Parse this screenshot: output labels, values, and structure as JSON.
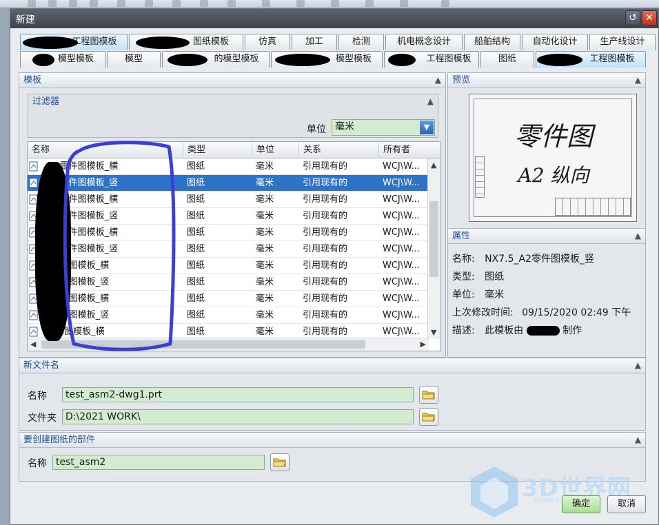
{
  "dialog": {
    "title": "新建",
    "tabs_row1": [
      "工程图模板",
      "图纸模板",
      "仿真",
      "加工",
      "检测",
      "机电概念设计",
      "船舶结构",
      "自动化设计",
      "生产线设计"
    ],
    "tabs_row2": [
      "模型模板",
      "模型",
      "的模型模板",
      "模型模板",
      "工程图模板",
      "图纸",
      "工程图模板"
    ]
  },
  "templates": {
    "header": "模板",
    "filter_label": "过滤器",
    "unit_label": "单位",
    "unit_value": "毫米",
    "columns": [
      "名称",
      "类型",
      "单位",
      "关系",
      "所有者"
    ],
    "rows": [
      {
        "name": "_A2零件图模板_横",
        "type": "图纸",
        "unit": "毫米",
        "relation": "引用现有的",
        "owner": "WCJ\\W..."
      },
      {
        "name": "_A2零件图模板_竖",
        "type": "图纸",
        "unit": "毫米",
        "relation": "引用现有的",
        "owner": "WCJ\\W...",
        "selected": true
      },
      {
        "name": "_A1零件图模板_横",
        "type": "图纸",
        "unit": "毫米",
        "relation": "引用现有的",
        "owner": "WCJ\\W..."
      },
      {
        "name": "_A1零件图模板_竖",
        "type": "图纸",
        "unit": "毫米",
        "relation": "引用现有的",
        "owner": "WCJ\\W..."
      },
      {
        "name": "_A0零件图模板_横",
        "type": "图纸",
        "unit": "毫米",
        "relation": "引用现有的",
        "owner": "WCJ\\W..."
      },
      {
        "name": "_A0零件图模板_竖",
        "type": "图纸",
        "unit": "毫米",
        "relation": "引用现有的",
        "owner": "WCJ\\W..."
      },
      {
        "name": "_A4总图模板_横",
        "type": "图纸",
        "unit": "毫米",
        "relation": "引用现有的",
        "owner": "WCJ\\W..."
      },
      {
        "name": "_A4总图模板_竖",
        "type": "图纸",
        "unit": "毫米",
        "relation": "引用现有的",
        "owner": "WCJ\\W..."
      },
      {
        "name": "_A3总图模板_横",
        "type": "图纸",
        "unit": "毫米",
        "relation": "引用现有的",
        "owner": "WCJ\\W..."
      },
      {
        "name": "_A3总图模板_竖",
        "type": "图纸",
        "unit": "毫米",
        "relation": "引用现有的",
        "owner": "WCJ\\W..."
      },
      {
        "name": "A2总图模板_横",
        "type": "图纸",
        "unit": "毫米",
        "relation": "引用现有的",
        "owner": "WCJ\\W..."
      }
    ]
  },
  "preview": {
    "header": "预览",
    "line1": "零件图",
    "line2": "A2 纵向"
  },
  "properties": {
    "header": "属性",
    "name_label": "名称:",
    "name_value": "NX7.5_A2零件图模板_竖",
    "type_label": "类型:",
    "type_value": "图纸",
    "unit_label": "单位:",
    "unit_value": "毫米",
    "modified_label": "上次修改时间:",
    "modified_value": "09/15/2020 02:49 下午",
    "desc_label": "描述:",
    "desc_prefix": "此模板由",
    "desc_suffix": "制作"
  },
  "new_file": {
    "header": "新文件名",
    "name_label": "名称",
    "name_value": "test_asm2-dwg1.prt",
    "folder_label": "文件夹",
    "folder_value": "D:\\2021 WORK\\"
  },
  "part": {
    "header": "要创建图纸的部件",
    "name_label": "名称",
    "name_value": "test_asm2"
  },
  "buttons": {
    "ok": "确定",
    "cancel": "取消"
  },
  "watermark": {
    "text": "3D世界网",
    "sub": "WWW.3DSJW.COM"
  },
  "colors": {
    "accent": "#2f73c6",
    "field_green": "#d3ebd1",
    "annotation_blue": "#3b3fd6",
    "header_text": "#1b4f9c"
  }
}
